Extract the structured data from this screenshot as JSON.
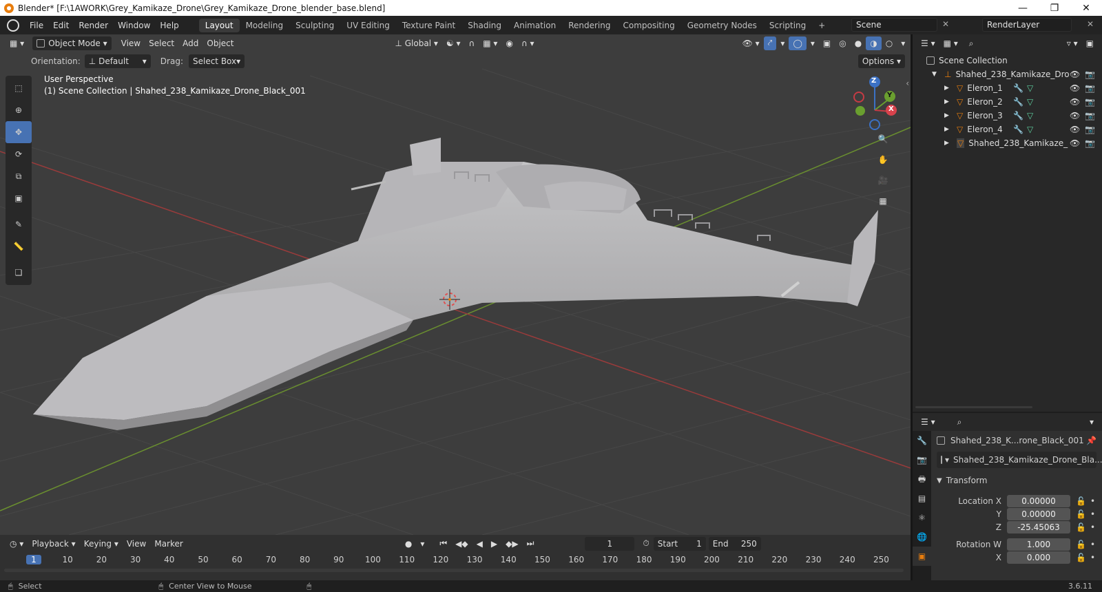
{
  "window": {
    "title": "Blender* [F:\\1AWORK\\Grey_Kamikaze_Drone\\Grey_Kamikaze_Drone_blender_base.blend]"
  },
  "menu": [
    "File",
    "Edit",
    "Render",
    "Window",
    "Help"
  ],
  "workspaces": [
    "Layout",
    "Modeling",
    "Sculpting",
    "UV Editing",
    "Texture Paint",
    "Shading",
    "Animation",
    "Rendering",
    "Compositing",
    "Geometry Nodes",
    "Scripting"
  ],
  "active_workspace": "Layout",
  "scene": "Scene",
  "render_layer": "RenderLayer",
  "viewport": {
    "mode": "Object Mode",
    "menus": [
      "View",
      "Select",
      "Add",
      "Object"
    ],
    "transform_orientation": "Global",
    "orientation_label": "Orientation:",
    "orientation_value": "Default",
    "drag_label": "Drag:",
    "drag_value": "Select Box",
    "options": "Options",
    "perspective": "User Perspective",
    "collection_info": "(1) Scene Collection | Shahed_238_Kamikaze_Drone_Black_001",
    "gizmo": {
      "x": "X",
      "y": "Y",
      "z": "Z"
    }
  },
  "outliner": {
    "root": "Scene Collection",
    "parent": "Shahed_238_Kamikaze_Dro",
    "items": [
      "Eleron_1",
      "Eleron_2",
      "Eleron_3",
      "Eleron_4",
      "Shahed_238_Kamikaze_"
    ]
  },
  "properties": {
    "object_name": "Shahed_238_K...rone_Black_001",
    "data_name": "Shahed_238_Kamikaze_Drone_Bla...",
    "panel": "Transform",
    "rows": [
      {
        "label": "Location X",
        "value": "0.00000"
      },
      {
        "label": "Y",
        "value": "0.00000"
      },
      {
        "label": "Z",
        "value": "-25.45063"
      },
      {
        "label": "Rotation W",
        "value": "1.000"
      },
      {
        "label": "X",
        "value": "0.000"
      }
    ]
  },
  "timeline": {
    "menus": [
      "Playback",
      "Keying",
      "View",
      "Marker"
    ],
    "current_frame": "1",
    "start_label": "Start",
    "start": "1",
    "end_label": "End",
    "end": "250",
    "ticks": [
      "1",
      "10",
      "20",
      "30",
      "40",
      "50",
      "60",
      "70",
      "80",
      "90",
      "100",
      "110",
      "120",
      "130",
      "140",
      "150",
      "160",
      "170",
      "180",
      "190",
      "200",
      "210",
      "220",
      "230",
      "240",
      "250"
    ]
  },
  "status": {
    "select": "Select",
    "center": "Center View to Mouse",
    "version": "3.6.11"
  },
  "colors": {
    "accent": "#4772b3",
    "orange": "#e87d0d"
  }
}
